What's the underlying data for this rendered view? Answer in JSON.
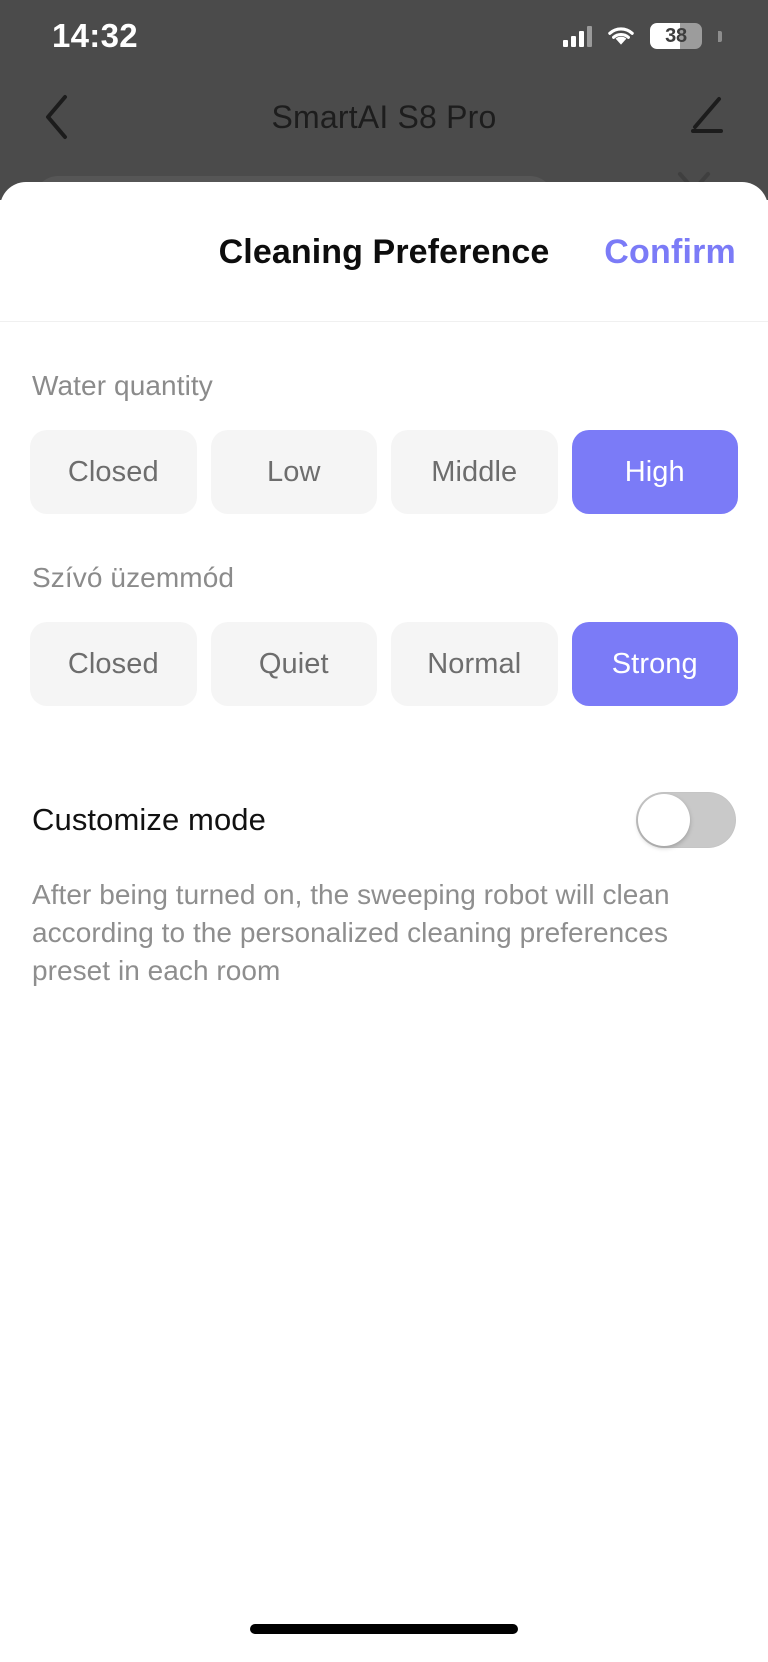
{
  "status_bar": {
    "time": "14:32",
    "battery_percent": "38",
    "signal_icon": "cellular-signal-icon",
    "wifi_icon": "wifi-icon",
    "battery_icon": "battery-icon"
  },
  "nav_bar": {
    "back_icon": "chevron-left-icon",
    "title": "SmartAI S8 Pro",
    "edit_icon": "pencil-edit-icon"
  },
  "sheet": {
    "title": "Cleaning Preference",
    "confirm_label": "Confirm",
    "accent_color": "#7b7bf7",
    "groups": [
      {
        "label": "Water quantity",
        "options": [
          {
            "label": "Closed",
            "selected": false
          },
          {
            "label": "Low",
            "selected": false
          },
          {
            "label": "Middle",
            "selected": false
          },
          {
            "label": "High",
            "selected": true
          }
        ]
      },
      {
        "label": "Szívó üzemmód",
        "options": [
          {
            "label": "Closed",
            "selected": false
          },
          {
            "label": "Quiet",
            "selected": false
          },
          {
            "label": "Normal",
            "selected": false
          },
          {
            "label": "Strong",
            "selected": true
          }
        ]
      }
    ],
    "customize": {
      "label": "Customize mode",
      "enabled": false,
      "description": "After being turned on, the sweeping robot will clean according to the personalized cleaning preferences preset in each room"
    }
  },
  "home_indicator": "home-indicator"
}
